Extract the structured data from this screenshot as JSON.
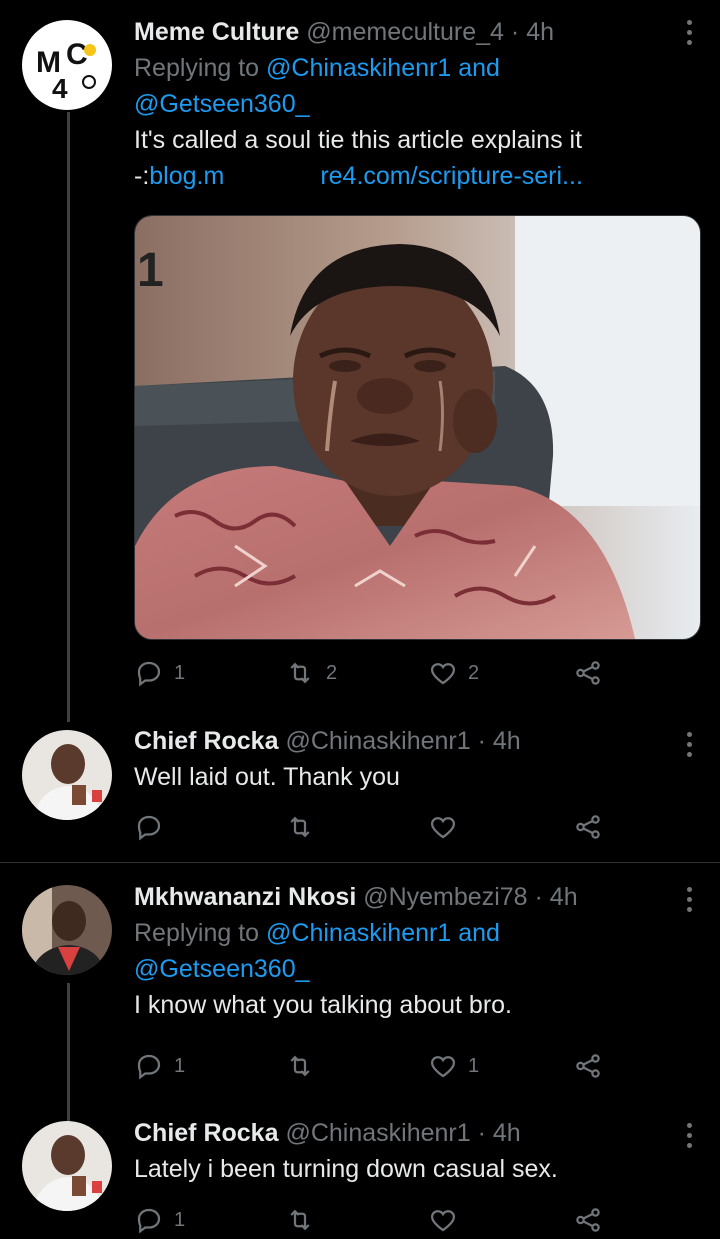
{
  "tweets": [
    {
      "name": "Meme Culture",
      "handle": "@memeculture_4",
      "sep": "·",
      "time": "4h",
      "replying_prefix": "Replying to",
      "mention1": "@Chinaskihenr1",
      "and": "and",
      "mention2": "@Getseen360_",
      "text": "It's called a soul tie this article explains it",
      "link_prefix": "-:",
      "link_part1": "blog.m",
      "link_part2": "re4.com/scripture-seri...",
      "avatar_text": "MC4",
      "replies": "1",
      "retweets": "2",
      "likes": "2"
    },
    {
      "name": "Chief Rocka",
      "handle": "@Chinaskihenr1",
      "sep": "·",
      "time": "4h",
      "text": "Well laid out. Thank you",
      "replies": "",
      "retweets": "",
      "likes": ""
    },
    {
      "name": "Mkhwananzi Nkosi",
      "handle": "@Nyembezi78",
      "sep": "·",
      "time": "4h",
      "replying_prefix": "Replying to",
      "mention1": "@Chinaskihenr1",
      "and": "and",
      "mention2": "@Getseen360_",
      "text": "I know what you talking about bro.",
      "replies": "1",
      "retweets": "",
      "likes": "1"
    },
    {
      "name": "Chief Rocka",
      "handle": "@Chinaskihenr1",
      "sep": "·",
      "time": "4h",
      "text": "Lately i been turning down casual sex.",
      "replies": "1",
      "retweets": "",
      "likes": ""
    }
  ],
  "colors": {
    "background": "#000000",
    "link": "#1d9bf0",
    "muted": "#71767b"
  }
}
